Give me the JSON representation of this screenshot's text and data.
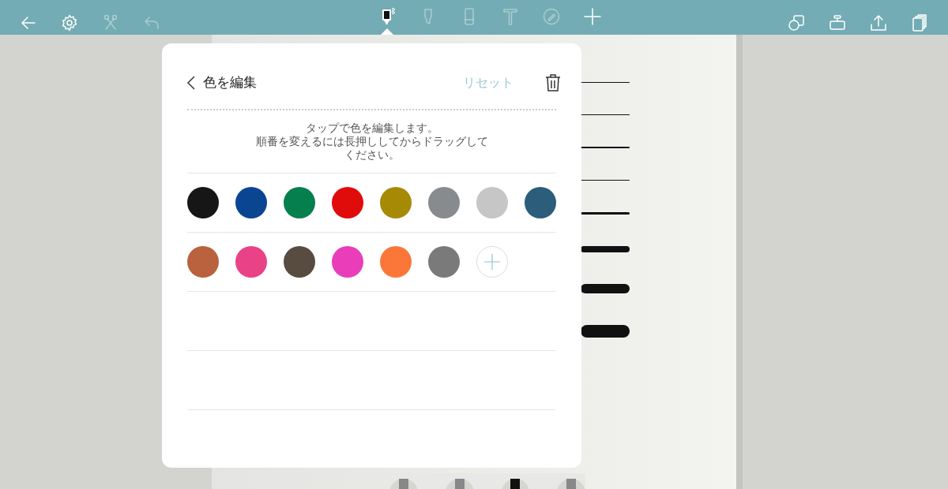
{
  "toolbar": {
    "left": [
      {
        "kind": "back",
        "disabled": false
      },
      {
        "kind": "settings",
        "disabled": false
      },
      {
        "kind": "scissors",
        "disabled": true
      },
      {
        "kind": "undo",
        "disabled": true
      }
    ],
    "tools": [
      {
        "kind": "pen",
        "selected": true,
        "disabled": false
      },
      {
        "kind": "highlighter",
        "selected": false,
        "disabled": true
      },
      {
        "kind": "eraser",
        "selected": false,
        "disabled": true
      },
      {
        "kind": "text",
        "selected": false,
        "disabled": true
      },
      {
        "kind": "lasso",
        "selected": false,
        "disabled": true
      },
      {
        "kind": "plus",
        "selected": false,
        "disabled": false
      }
    ],
    "right": [
      {
        "kind": "shapes",
        "disabled": false
      },
      {
        "kind": "tape",
        "disabled": false
      },
      {
        "kind": "share",
        "disabled": false
      },
      {
        "kind": "pages",
        "disabled": false
      }
    ]
  },
  "popover": {
    "title": "色を編集",
    "reset": "リセット",
    "hint": [
      "タップで色を編集します。",
      "順番を変えるには長押ししてからドラッグして",
      "ください。"
    ],
    "rows": [
      [
        {
          "kind": "swatch",
          "color": "#161616"
        },
        {
          "kind": "swatch",
          "color": "#0a4592"
        },
        {
          "kind": "swatch",
          "color": "#067f4f"
        },
        {
          "kind": "swatch",
          "color": "#e00b0b"
        },
        {
          "kind": "swatch",
          "color": "#a68a05"
        },
        {
          "kind": "swatch",
          "color": "#878b8e"
        },
        {
          "kind": "swatch",
          "color": "#c6c6c6"
        },
        {
          "kind": "swatch",
          "color": "#2c5d7a"
        }
      ],
      [
        {
          "kind": "swatch",
          "color": "#b9623d"
        },
        {
          "kind": "swatch",
          "color": "#ea4286"
        },
        {
          "kind": "swatch",
          "color": "#584c41"
        },
        {
          "kind": "swatch",
          "color": "#e93dba"
        },
        {
          "kind": "swatch",
          "color": "#fb7739"
        },
        {
          "kind": "swatch",
          "color": "#7a7a7a"
        },
        {
          "kind": "add"
        }
      ],
      [],
      []
    ]
  }
}
